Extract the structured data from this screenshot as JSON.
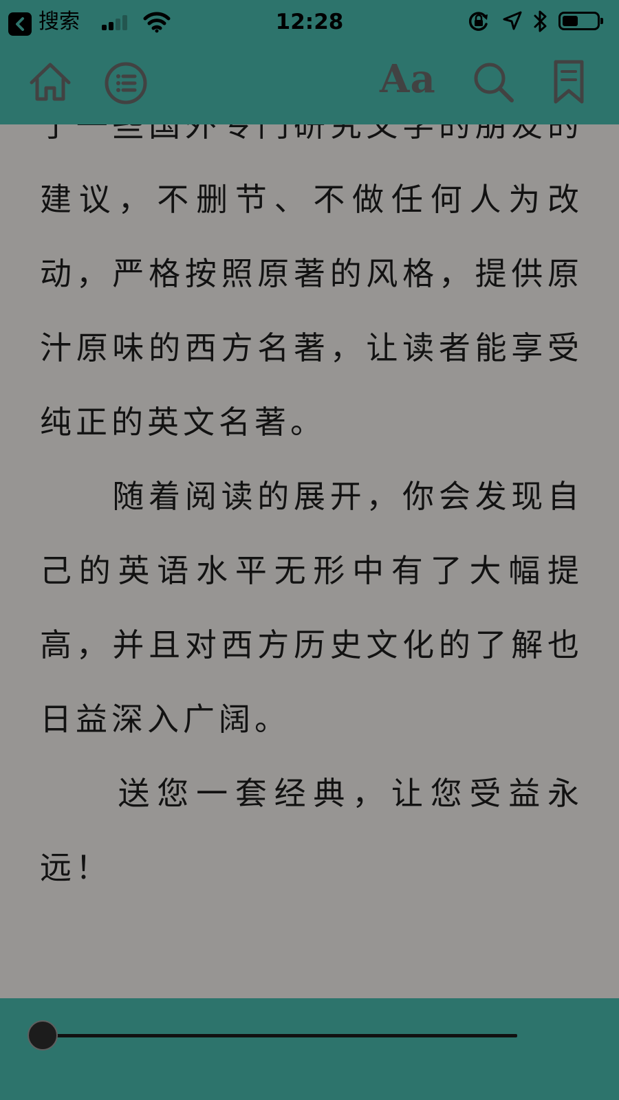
{
  "status_bar": {
    "back_label": "搜索",
    "time": "12:28",
    "battery_level": 0.45
  },
  "toolbar": {
    "home_icon": "home-icon",
    "toc_icon": "list-icon",
    "font_label": "Aa",
    "search_icon": "search-icon",
    "bookmark_icon": "bookmark-icon"
  },
  "content": {
    "paragraphs": [
      "了一些国外专门研究文学的朋友的建议，不删节、不做任何人为改动，严格按照原著的风格，提供原汁原味的西方名著，让读者能享受纯正的英文名著。",
      "　　随着阅读的展开，你会发现自己的英语水平无形中有了大幅提高，并且对西方历史文化的了解也日益深入广阔。",
      "　　送您一套经典，让您受益永远！"
    ]
  },
  "progress": {
    "value": 0.0
  },
  "colors": {
    "bar": "#2d746c",
    "page": "#979593",
    "text": "#121212",
    "icon": "#424242"
  }
}
